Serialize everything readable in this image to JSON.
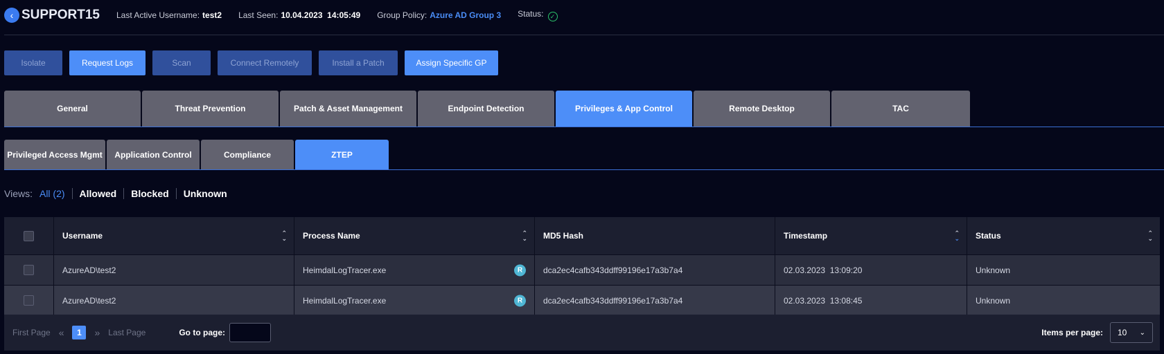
{
  "header": {
    "device": "SUPPORT15",
    "last_active_label": "Last Active Username:",
    "last_active_value": "test2",
    "last_seen_label": "Last Seen:",
    "last_seen_value": "10.04.2023  14:05:49",
    "group_policy_label": "Group Policy:",
    "group_policy_value": "Azure AD Group 3",
    "status_label": "Status:",
    "status_icon": "check-circle-icon",
    "status_color": "#2bc36b"
  },
  "actions": [
    {
      "label": "Isolate",
      "enabled": false
    },
    {
      "label": "Request Logs",
      "enabled": true
    },
    {
      "label": "Scan",
      "enabled": false
    },
    {
      "label": "Connect Remotely",
      "enabled": false
    },
    {
      "label": "Install a Patch",
      "enabled": false
    },
    {
      "label": "Assign Specific GP",
      "enabled": true
    }
  ],
  "tabs": [
    {
      "label": "General"
    },
    {
      "label": "Threat Prevention"
    },
    {
      "label": "Patch & Asset Management"
    },
    {
      "label": "Endpoint Detection"
    },
    {
      "label": "Privileges & App Control",
      "active": true
    },
    {
      "label": "Remote Desktop"
    },
    {
      "label": "TAC"
    }
  ],
  "subtabs": [
    {
      "label": "Privileged Access Mgmt"
    },
    {
      "label": "Application Control"
    },
    {
      "label": "Compliance"
    },
    {
      "label": "ZTEP",
      "active": true
    }
  ],
  "views": {
    "label": "Views:",
    "items": [
      "All (2)",
      "Allowed",
      "Blocked",
      "Unknown"
    ],
    "selected": "All (2)"
  },
  "table": {
    "columns": [
      "Username",
      "Process Name",
      "MD5 Hash",
      "Timestamp",
      "Status"
    ],
    "sorted_column": "Timestamp",
    "rows": [
      {
        "username": "AzureAD\\test2",
        "process": "HeimdalLogTracer.exe",
        "badge": "R",
        "md5": "dca2ec4cafb343ddff99196e17a3b7a4",
        "timestamp": "02.03.2023  13:09:20",
        "status": "Unknown"
      },
      {
        "username": "AzureAD\\test2",
        "process": "HeimdalLogTracer.exe",
        "badge": "R",
        "md5": "dca2ec4cafb343ddff99196e17a3b7a4",
        "timestamp": "02.03.2023  13:08:45",
        "status": "Unknown"
      }
    ]
  },
  "pager": {
    "first": "First Page",
    "current": "1",
    "last": "Last Page",
    "goto_label": "Go to page:",
    "goto_value": "",
    "ipp_label": "Items per page:",
    "ipp_value": "10"
  },
  "colors": {
    "accent": "#4d8ef8",
    "background": "#05071a",
    "tab_inactive": "#62626f",
    "badge": "#4fb6d4"
  }
}
